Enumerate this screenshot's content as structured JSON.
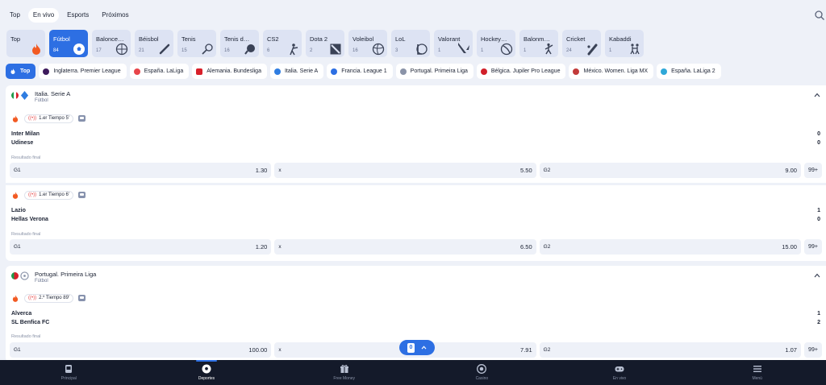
{
  "top_tabs": [
    "Top",
    "En vivo",
    "Esports",
    "Próximos"
  ],
  "active_top_tab": "En vivo",
  "sports": [
    {
      "label": "Top",
      "count": "",
      "icon": "fire-icon"
    },
    {
      "label": "Fútbol",
      "count": "84",
      "icon": "soccer-ball-icon"
    },
    {
      "label": "Balonce…",
      "count": "17",
      "icon": "basketball-icon"
    },
    {
      "label": "Béisbol",
      "count": "21",
      "icon": "baseball-bat-icon"
    },
    {
      "label": "Tenis",
      "count": "15",
      "icon": "tennis-racket-icon"
    },
    {
      "label": "Tenis d…",
      "count": "16",
      "icon": "table-tennis-icon"
    },
    {
      "label": "CS2",
      "count": "6",
      "icon": "cs2-soldier-icon"
    },
    {
      "label": "Dota 2",
      "count": "2",
      "icon": "dota2-icon"
    },
    {
      "label": "Voleibol",
      "count": "16",
      "icon": "volleyball-icon"
    },
    {
      "label": "LoL",
      "count": "3",
      "icon": "lol-icon"
    },
    {
      "label": "Valorant",
      "count": "1",
      "icon": "valorant-icon"
    },
    {
      "label": "Hockey…",
      "count": "1",
      "icon": "hockey-icon"
    },
    {
      "label": "Balonm…",
      "count": "1",
      "icon": "handball-icon"
    },
    {
      "label": "Cricket",
      "count": "24",
      "icon": "cricket-icon"
    },
    {
      "label": "Kabaddi",
      "count": "1",
      "icon": "kabaddi-icon"
    }
  ],
  "leagues": [
    {
      "label": "Top",
      "color": "#ffffff"
    },
    {
      "label": "Inglaterra. Premier League",
      "color": "#3d1a5c"
    },
    {
      "label": "España. LaLiga",
      "color": "#e8454a"
    },
    {
      "label": "Alemania. Bundesliga",
      "color": "#d8202a"
    },
    {
      "label": "Italia. Serie A",
      "color": "#2f7de1"
    },
    {
      "label": "Francia. League 1",
      "color": "#2d6fe3"
    },
    {
      "label": "Portugal. Primeira Liga",
      "color": "#8a93a8"
    },
    {
      "label": "Bélgica. Jupiler Pro League",
      "color": "#d1202a"
    },
    {
      "label": "México. Women. Liga MX",
      "color": "#c23a3a"
    },
    {
      "label": "España. LaLiga 2",
      "color": "#2fa8d8"
    }
  ],
  "groups": [
    {
      "title": "Italia. Serie A",
      "subtitle": "Fútbol",
      "matches": [
        {
          "status": "1.er Tiempo 5'",
          "home": "Inter Milan",
          "away": "Udinese",
          "home_score": "0",
          "away_score": "0",
          "market": "Resultado final",
          "odds": [
            {
              "k": "G1",
              "v": "1.30"
            },
            {
              "k": "x",
              "v": "5.50"
            },
            {
              "k": "G2",
              "v": "9.00"
            }
          ],
          "more": "99+"
        },
        {
          "status": "1.er Tiempo 6'",
          "home": "Lazio",
          "away": "Hellas Verona",
          "home_score": "1",
          "away_score": "0",
          "market": "Resultado final",
          "odds": [
            {
              "k": "G1",
              "v": "1.20"
            },
            {
              "k": "x",
              "v": "6.50"
            },
            {
              "k": "G2",
              "v": "15.00"
            }
          ],
          "more": "99+"
        }
      ]
    },
    {
      "title": "Portugal. Primeira Liga",
      "subtitle": "Fútbol",
      "matches": [
        {
          "status": "2.º Tiempo 89'",
          "home": "Alverca",
          "away": "SL Benfica FC",
          "home_score": "1",
          "away_score": "2",
          "market": "Resultado final",
          "odds": [
            {
              "k": "G1",
              "v": "100.00"
            },
            {
              "k": "x",
              "v": "7.91"
            },
            {
              "k": "G2",
              "v": "1.07"
            }
          ],
          "more": "99+"
        }
      ]
    }
  ],
  "coupon": {
    "count": "0"
  },
  "bottom_nav": [
    {
      "label": "Principal",
      "icon": "home-icon"
    },
    {
      "label": "Deportes",
      "icon": "soccer-ball-icon"
    },
    {
      "label": "Free Money",
      "icon": "gift-icon"
    },
    {
      "label": "Casino",
      "icon": "casino-chip-icon"
    },
    {
      "label": "En vivo",
      "icon": "gamepad-icon"
    },
    {
      "label": "Menú",
      "icon": "menu-icon"
    }
  ],
  "active_bottom": "Deportes",
  "colors": {
    "accent": "#2d6fe3",
    "background": "#eef1f8",
    "bottom_bar": "#141a2a",
    "fire": "#f25a22"
  }
}
